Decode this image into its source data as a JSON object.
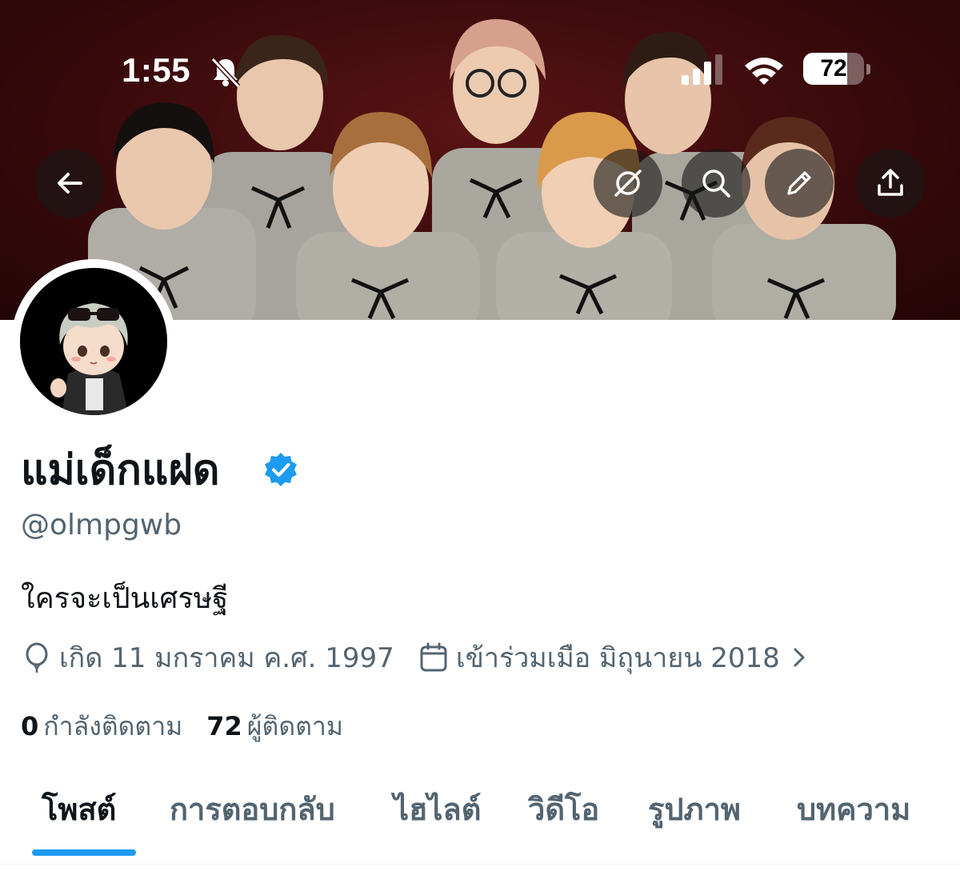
{
  "status_bar": {
    "time": "1:55",
    "battery": "72",
    "battery_level": 0.72
  },
  "banner": {
    "background_color": "#3a0a0c",
    "buttons": [
      {
        "name": "back-button",
        "icon": "arrow-left-icon"
      },
      {
        "name": "grok-button",
        "icon": "circle-slash-icon"
      },
      {
        "name": "search-button",
        "icon": "search-icon"
      },
      {
        "name": "edit-button",
        "icon": "pencil-icon"
      },
      {
        "name": "share-button",
        "icon": "share-upload-icon"
      }
    ]
  },
  "profile": {
    "display_name": "แม่เด็กแฝด",
    "verified_color": "#1d9bf0",
    "handle": "@olmpgwb",
    "bio": "ใครจะเป็นเศรษฐี",
    "birth": "เกิด 11 มกราคม ค.ศ. 1997",
    "joined": "เข้าร่วมเมือ มิถุนายน 2018",
    "following_count": "0",
    "following_label": "กำลังติดตาม",
    "followers_count": "72",
    "followers_label": "ผู้ติดตาม"
  },
  "tabs": [
    {
      "label": "โพสต์",
      "active": true
    },
    {
      "label": "การตอบกลับ",
      "active": false
    },
    {
      "label": "ไฮไลต์",
      "active": false
    },
    {
      "label": "วิดีโอ",
      "active": false
    },
    {
      "label": "รูปภาพ",
      "active": false
    },
    {
      "label": "บทความ",
      "active": false
    }
  ],
  "colors": {
    "accent": "#1d9bf0",
    "secondary_text": "#536471",
    "primary_text": "#0f1419"
  }
}
